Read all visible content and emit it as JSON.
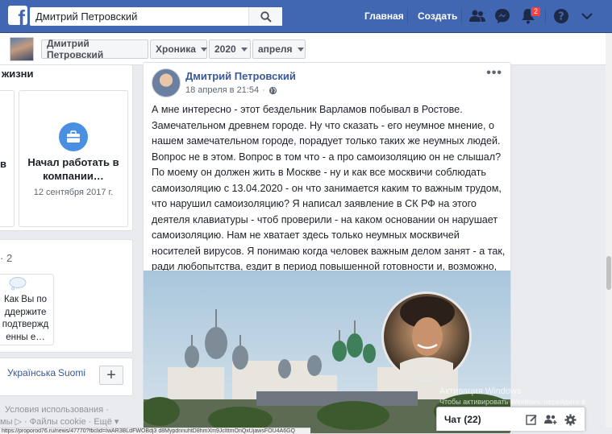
{
  "topbar": {
    "search_value": "Дмитрий Петровский",
    "nav_home": "Главная",
    "nav_create": "Создать",
    "notifications_count": "2"
  },
  "subbar": {
    "name": "Дмитрий Петровский",
    "section": "Хроника",
    "year": "2020",
    "month": "апреля"
  },
  "left": {
    "header_cut": "жизни",
    "cut_letter": "в",
    "work_title": "Начал работать в компании…",
    "work_date": "12 сентября 2017 г.",
    "count_cut": "· 2",
    "support_text": "Как Вы поддержите подтвержденны е…",
    "langs": [
      "Українська",
      "Suomi"
    ],
    "plus": "+",
    "footer_line1": "Условия использования ·",
    "footer_line2": "мы ▷ · Файлы cookie · Ещё ▾"
  },
  "post": {
    "author": "Дмитрий Петровский",
    "time": "18 апреля в 21:54",
    "menu": "•••",
    "text": "А мне интересно - этот бездельник Варламов побывал в Ростове. Замечательном древнем городе. Ну что сказать - его неумное мнение, о нашем замечательном городе, порадует только таких же неумных людей. Вопрос не в этом. Вопрос в том что - а про самоизоляцию он не слышал? По моему он должен жить в Москве - ну и как все москвичи соблюдать самоизоляцию с 13.04.2020 - он что занимается каким то важным трудом, что нарушил самоизоляцию? Я написал заявление в СК РФ на этого деятеля клавиатуры - чтоб проверили - на каком основании он нарушает самоизоляцию. Нам не хватает здесь только неумных москвичей носителей вирусов. Я понимаю когда человек важным делом занят - а так, ради любопытства, ездит в период повышенной готовности и, возможно, является источником вирусной инфекции в других регионах."
  },
  "chat": {
    "label": "Чат (22)"
  },
  "overlay": {
    "activate_title": "Активация Windows",
    "activate_sub": "Чтобы активировать Windows, перейдите в раздел \"Параметры\"."
  },
  "status_url": "https://proporod76.ru/news/47770?fbclid=IwAR3BLdFWOBdj3 d8MypdnnuhtD8hmXm9JcIttmOnQxUjawsFOU4A6GQ"
}
